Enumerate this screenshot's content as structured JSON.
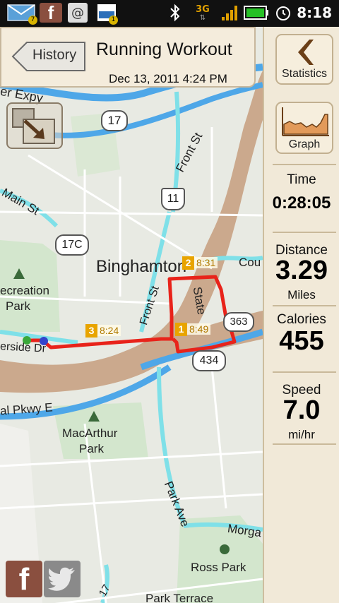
{
  "status_bar": {
    "email_count": "7",
    "amazon_count": "1",
    "network": "3G",
    "clock": "8:18"
  },
  "header": {
    "back_label": "History",
    "title": "Running Workout",
    "date": "Dec 13, 2011 4:24 PM"
  },
  "side": {
    "statistics_label": "Statistics",
    "graph_label": "Graph",
    "stats": [
      {
        "label": "Time",
        "value": "0:28:05",
        "unit": ""
      },
      {
        "label": "Distance",
        "value": "3.29",
        "unit": "Miles"
      },
      {
        "label": "Calories",
        "value": "455",
        "unit": ""
      },
      {
        "label": "Speed",
        "value": "7.0",
        "unit": "mi/hr"
      }
    ]
  },
  "map": {
    "labels": {
      "expwy": "er Expy",
      "main_st": "Main St",
      "front_st_n": "Front St",
      "front_st_s": "Front St",
      "city": "Binghamton",
      "state_st": "State",
      "court": "Cou",
      "recreation_park_1": "ecreation",
      "recreation_park_2": "Park",
      "riverside": "erside Dr",
      "parkway": "al Pkwy E",
      "macarthur_1": "MacArthur",
      "macarthur_2": "Park",
      "park_ave": "Park Ave",
      "morgan": "Morga",
      "ross_park": "Ross Park",
      "park_terrace": "Park Terrace",
      "shield_17": "17",
      "shield_11": "11",
      "shield_17c": "17C",
      "shield_363": "363",
      "shield_434": "434",
      "shield_17b": "17"
    },
    "markers": [
      {
        "num": "1",
        "time": "8:49"
      },
      {
        "num": "2",
        "time": "8:31"
      },
      {
        "num": "3",
        "time": "8:24"
      }
    ]
  },
  "colors": {
    "route": "#e8231a",
    "highway": "#4ea7e8",
    "road_cyan": "#7fe0e8",
    "river": "#c8a88c",
    "panel": "#f1e9d8"
  }
}
